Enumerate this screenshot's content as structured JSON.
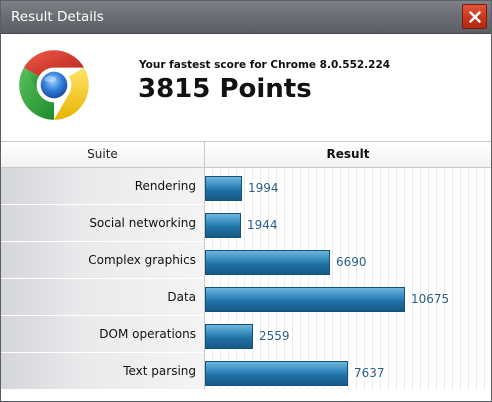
{
  "window": {
    "title": "Result Details",
    "close_label": "X"
  },
  "header": {
    "subtitle": "Your fastest score for Chrome 8.0.552.224",
    "score_value": "3815",
    "score_unit": "Points",
    "logo_icon": "chrome-logo-icon"
  },
  "table": {
    "col_suite": "Suite",
    "col_result": "Result",
    "max_value": 10675,
    "rows": [
      {
        "label": "Rendering",
        "value": 1994,
        "value_text": "1994"
      },
      {
        "label": "Social networking",
        "value": 1944,
        "value_text": "1944"
      },
      {
        "label": "Complex graphics",
        "value": 6690,
        "value_text": "6690"
      },
      {
        "label": "Data",
        "value": 10675,
        "value_text": "10675"
      },
      {
        "label": "DOM operations",
        "value": 2559,
        "value_text": "2559"
      },
      {
        "label": "Text parsing",
        "value": 7637,
        "value_text": "7637"
      }
    ]
  },
  "colors": {
    "titlebar": "#6b6f75",
    "close_button": "#c8361c",
    "bar": "#1f6fa3",
    "value_text": "#2a5f8a"
  }
}
